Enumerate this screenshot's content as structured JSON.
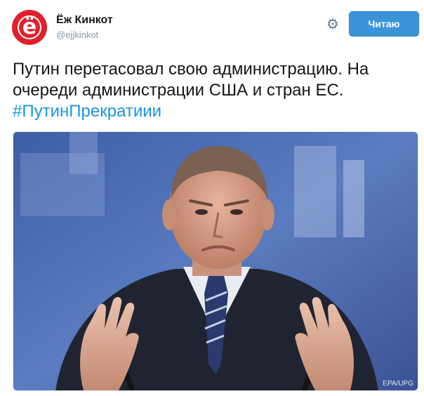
{
  "author": {
    "name": "Ёж Кинкот",
    "handle": "@ejjkinkot",
    "avatar_letter": "ё",
    "avatar_color": "#e0202a"
  },
  "actions": {
    "gear_icon": "gear-icon",
    "follow_label": "Читаю",
    "follow_color": "#3b94d9"
  },
  "tweet": {
    "text": "Путин перетасовал свою администрацию. На очереди администрации США и стран ЕС.",
    "hashtag": "#ПутинПрекратиии",
    "hashtag_color": "#1b95e0"
  },
  "media": {
    "credit": "EPA/UPG"
  }
}
